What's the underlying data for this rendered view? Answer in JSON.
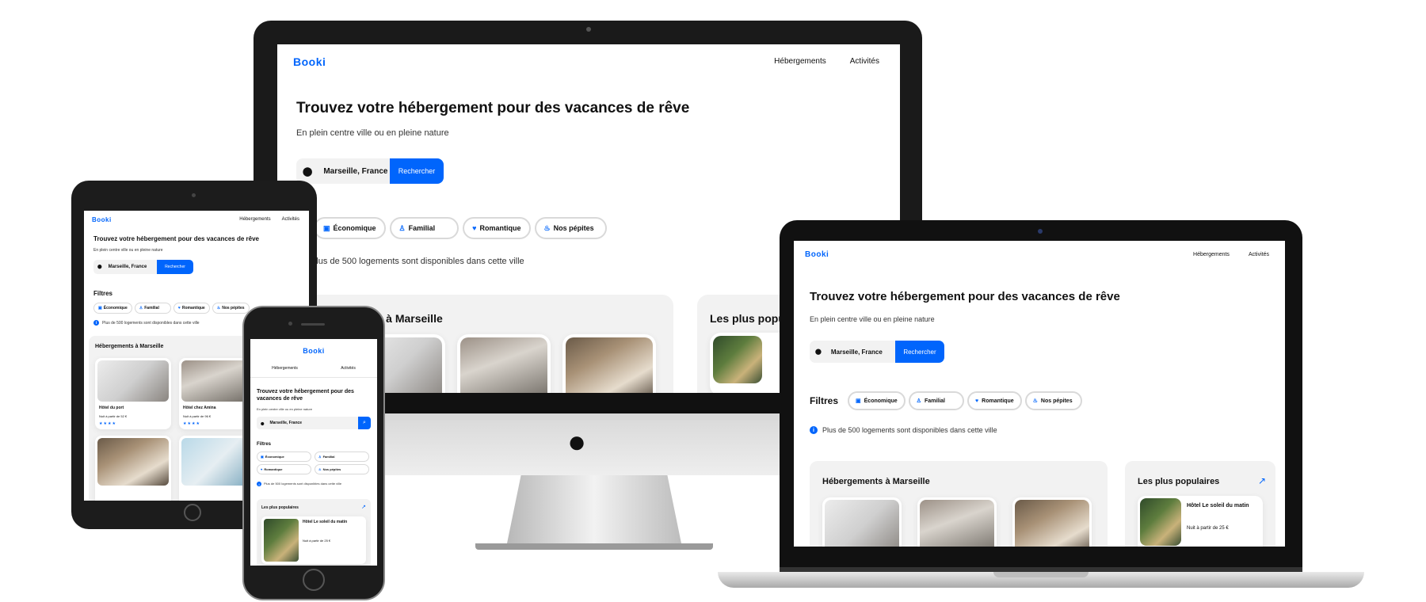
{
  "site": {
    "logo": "Booki",
    "nav": [
      "Hébergements",
      "Activités"
    ],
    "hero_title": "Trouvez votre hébergement pour des vacances de rêve",
    "hero_subtitle": "En plein centre ville ou en pleine nature",
    "search_value": "Marseille, France",
    "search_button": "Rechercher",
    "filters_label": "Filtres",
    "filters": [
      {
        "label": "Économique",
        "icon": "money-icon"
      },
      {
        "label": "Familial",
        "icon": "child-icon"
      },
      {
        "label": "Romantique",
        "icon": "heart-icon"
      },
      {
        "label": "Nos pépites",
        "icon": "fire-icon"
      }
    ],
    "info_text": "Plus de 500 logements sont disponibles dans cette ville",
    "section_lodging": "Hébergements à Marseille",
    "section_popular": "Les plus populaires",
    "lodgings": [
      {
        "name": "Hôtel du port",
        "price": "Nuit à partir de 52 €",
        "stars": "★★★★"
      },
      {
        "name": "Hôtel chez Amina",
        "price": "Nuit à partir de 96 €",
        "stars": "★★★★"
      }
    ],
    "popular": {
      "name": "Hôtel Le soleil du matin",
      "price": "Nuit à partir de 25 €"
    }
  },
  "colors": {
    "accent": "#0065fc",
    "panel": "#f2f2f2",
    "border": "#d9d9d9"
  },
  "icons": {
    "pin": "location-pin-icon",
    "trend": "trend-chart-icon",
    "apple": "apple-logo-icon",
    "info": "info-icon",
    "search": "search-icon"
  }
}
